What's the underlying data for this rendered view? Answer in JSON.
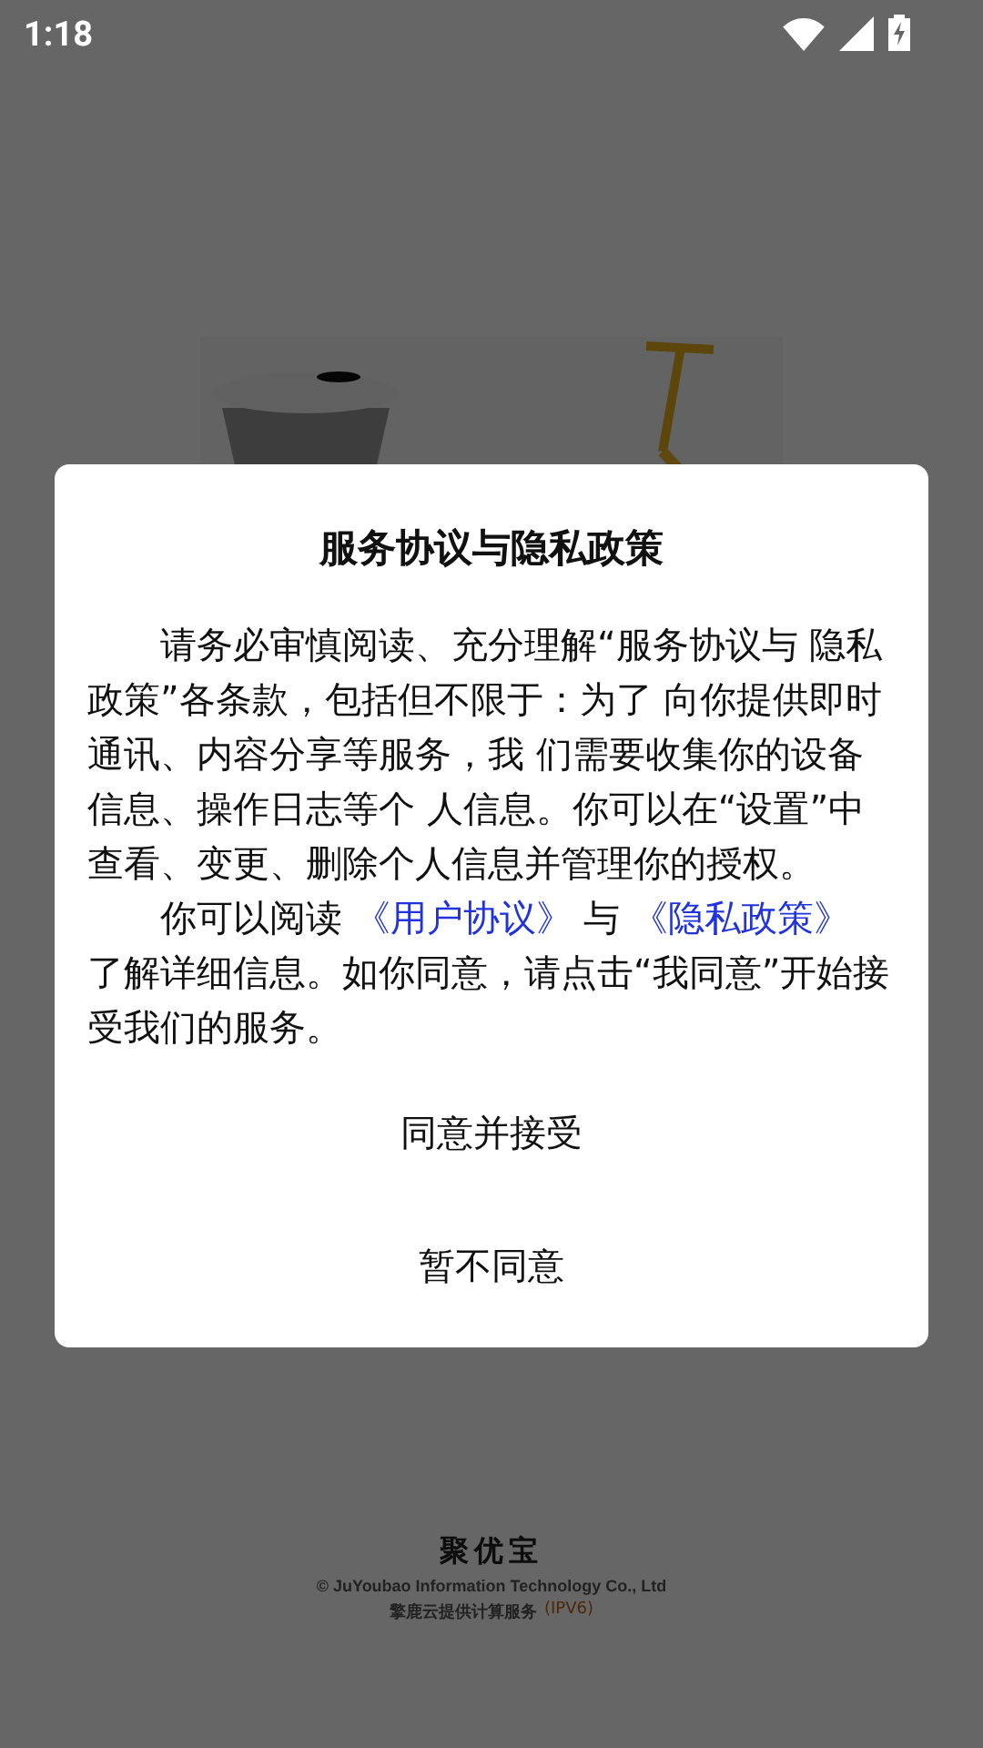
{
  "status_bar": {
    "time": "1:18"
  },
  "splash": {
    "kind": "picture",
    "app_name": "聚优宝",
    "copyright": "© JuYoubao Information Technology Co., Ltd",
    "hosting": "擎鹿云提供计算服务",
    "hosting_tag": "(IPV6)"
  },
  "dialog": {
    "title": "服务协议与隐私政策",
    "paragraphs": [
      [
        {
          "kind": "text",
          "text": "请务必审慎阅读、充分理解“服务协议与 隐私政策”各条款，包括但不限于：为了 向你提供即时通讯、内容分享等服务，我 们需要收集你的设备信息、操作日志等个 人信息。你可以在“设置”中查看、变更、删除个人信息并管理你的授权。"
        }
      ],
      [
        {
          "kind": "text",
          "text": "你可以阅读"
        },
        {
          "kind": "link",
          "text": "《用户协议》"
        },
        {
          "kind": "text",
          "text": "与"
        },
        {
          "kind": "link",
          "text": "《隐私政策》"
        },
        {
          "kind": "text",
          "text": "了解详细信息。如你同意，请点击“我同意”开始接受我们的服务。"
        }
      ]
    ],
    "buttons": [
      "同意并接受",
      "暂不同意"
    ]
  }
}
